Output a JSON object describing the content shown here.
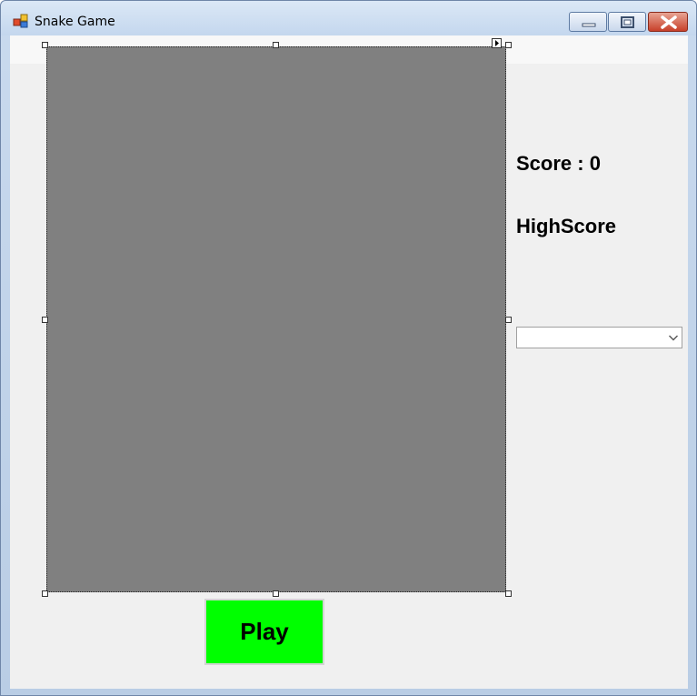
{
  "window": {
    "title": "Snake Game",
    "app_icon": "form-icon",
    "controls": {
      "minimize_icon": "minimize-icon",
      "maximize_icon": "maximize-icon",
      "close_icon": "close-icon"
    }
  },
  "game": {
    "board_color": "#808080",
    "score_label": "Score : 0",
    "highscore_label": "HighScore",
    "dropdown_value": "",
    "play_label": "Play",
    "play_color": "#00ff00"
  },
  "designer": {
    "smart_tag_icon": "smart-tag-arrow-icon"
  }
}
